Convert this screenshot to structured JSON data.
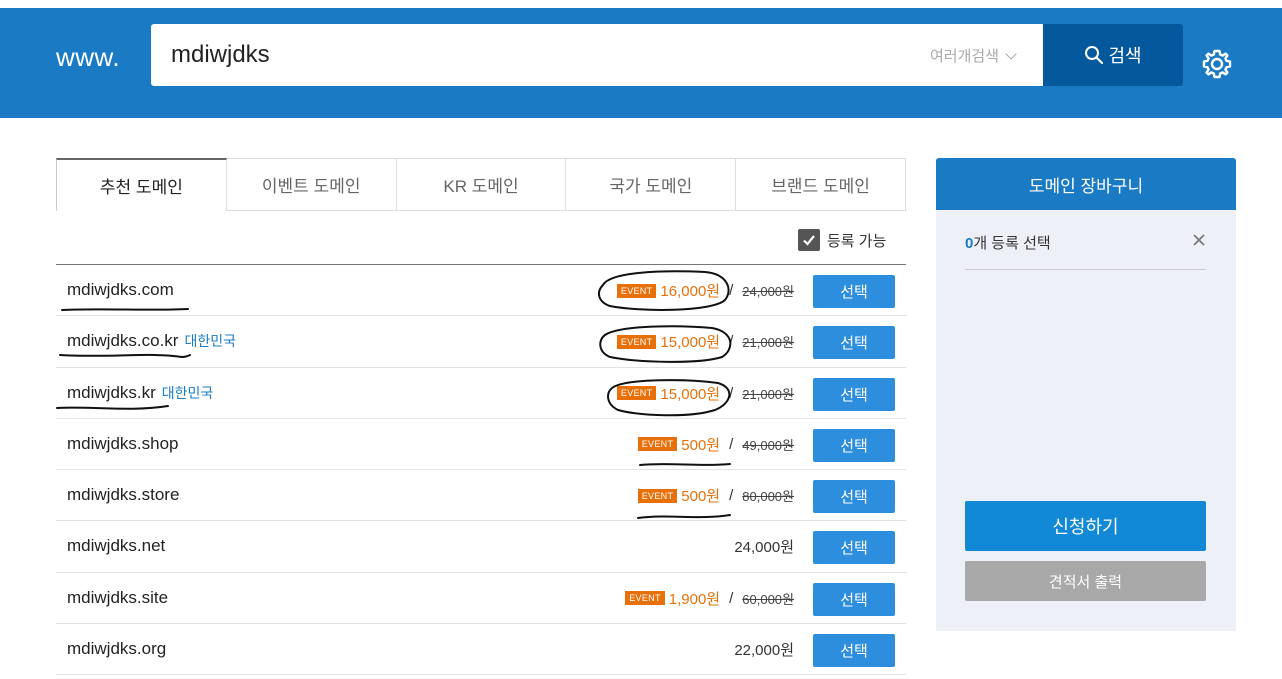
{
  "header": {
    "www_label": "www.",
    "search_value": "mdiwjdks",
    "multi_search_label": "여러개검색",
    "search_button_label": "검색"
  },
  "tabs": [
    {
      "label": "추천 도메인",
      "active": true
    },
    {
      "label": "이벤트 도메인",
      "active": false
    },
    {
      "label": "KR 도메인",
      "active": false
    },
    {
      "label": "국가 도메인",
      "active": false
    },
    {
      "label": "브랜드 도메인",
      "active": false
    }
  ],
  "filter": {
    "available_label": "등록 가능",
    "checked": true
  },
  "domains": [
    {
      "name": "mdiwjdks.com",
      "country": "",
      "badge": "EVENT",
      "price": "16,000원",
      "separator": "/",
      "original": "24,000원",
      "button": "선택"
    },
    {
      "name": "mdiwjdks.co.kr",
      "country": "대한민국",
      "badge": "EVENT",
      "price": "15,000원",
      "separator": "/",
      "original": "21,000원",
      "button": "선택"
    },
    {
      "name": "mdiwjdks.kr",
      "country": "대한민국",
      "badge": "EVENT",
      "price": "15,000원",
      "separator": "/",
      "original": "21,000원",
      "button": "선택"
    },
    {
      "name": "mdiwjdks.shop",
      "country": "",
      "badge": "EVENT",
      "price": "500원",
      "separator": "/",
      "original": "49,000원",
      "button": "선택"
    },
    {
      "name": "mdiwjdks.store",
      "country": "",
      "badge": "EVENT",
      "price": "500원",
      "separator": "/",
      "original": "80,000원",
      "button": "선택"
    },
    {
      "name": "mdiwjdks.net",
      "country": "",
      "badge": "",
      "price": "24,000원",
      "separator": "",
      "original": "",
      "button": "선택"
    },
    {
      "name": "mdiwjdks.site",
      "country": "",
      "badge": "EVENT",
      "price": "1,900원",
      "separator": "/",
      "original": "60,000원",
      "button": "선택"
    },
    {
      "name": "mdiwjdks.org",
      "country": "",
      "badge": "",
      "price": "22,000원",
      "separator": "",
      "original": "",
      "button": "선택"
    }
  ],
  "cart": {
    "title": "도메인 장바구니",
    "count": "0",
    "count_suffix": "개 등록 선택",
    "apply_label": "신청하기",
    "quote_label": "견적서 출력"
  },
  "colors": {
    "brand_blue": "#1a7bc4",
    "search_button": "#05589c",
    "event_orange": "#e8700a",
    "select_button": "#2d8ede"
  }
}
